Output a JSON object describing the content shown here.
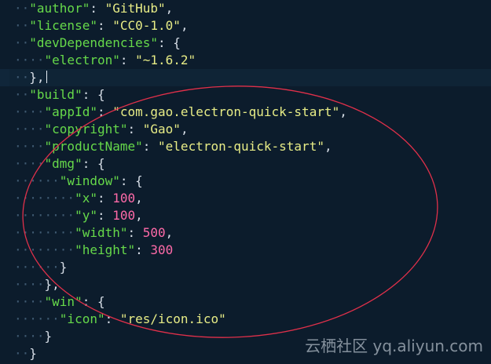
{
  "editor": {
    "lines": [
      {
        "indent": 1,
        "tokens": [
          {
            "t": "k",
            "v": "\"author\""
          },
          {
            "t": "p",
            "v": ": "
          },
          {
            "t": "s",
            "v": "\"GitHub\""
          },
          {
            "t": "p",
            "v": ","
          }
        ]
      },
      {
        "indent": 1,
        "tokens": [
          {
            "t": "k",
            "v": "\"license\""
          },
          {
            "t": "p",
            "v": ": "
          },
          {
            "t": "s",
            "v": "\"CC0-1.0\""
          },
          {
            "t": "p",
            "v": ","
          }
        ]
      },
      {
        "indent": 1,
        "tokens": [
          {
            "t": "k",
            "v": "\"devDependencies\""
          },
          {
            "t": "p",
            "v": ": {"
          }
        ]
      },
      {
        "indent": 2,
        "tokens": [
          {
            "t": "k",
            "v": "\"electron\""
          },
          {
            "t": "p",
            "v": ": "
          },
          {
            "t": "s",
            "v": "\"~1.6.2\""
          }
        ]
      },
      {
        "indent": 1,
        "active": true,
        "cursor": true,
        "tokens": [
          {
            "t": "p",
            "v": "},"
          }
        ]
      },
      {
        "indent": 1,
        "tokens": [
          {
            "t": "k",
            "v": "\"build\""
          },
          {
            "t": "p",
            "v": ": {"
          }
        ]
      },
      {
        "indent": 2,
        "tokens": [
          {
            "t": "k",
            "v": "\"appId\""
          },
          {
            "t": "p",
            "v": ": "
          },
          {
            "t": "s",
            "v": "\"com.gao.electron-quick-start\""
          },
          {
            "t": "p",
            "v": ","
          }
        ]
      },
      {
        "indent": 2,
        "tokens": [
          {
            "t": "k",
            "v": "\"copyright\""
          },
          {
            "t": "p",
            "v": ": "
          },
          {
            "t": "s",
            "v": "\"Gao\""
          },
          {
            "t": "p",
            "v": ","
          }
        ]
      },
      {
        "indent": 2,
        "tokens": [
          {
            "t": "k",
            "v": "\"productName\""
          },
          {
            "t": "p",
            "v": ": "
          },
          {
            "t": "s",
            "v": "\"electron-quick-start\""
          },
          {
            "t": "p",
            "v": ","
          }
        ]
      },
      {
        "indent": 2,
        "tokens": [
          {
            "t": "k",
            "v": "\"dmg\""
          },
          {
            "t": "p",
            "v": ": {"
          }
        ]
      },
      {
        "indent": 3,
        "tokens": [
          {
            "t": "k",
            "v": "\"window\""
          },
          {
            "t": "p",
            "v": ": {"
          }
        ]
      },
      {
        "indent": 4,
        "tokens": [
          {
            "t": "k",
            "v": "\"x\""
          },
          {
            "t": "p",
            "v": ": "
          },
          {
            "t": "n",
            "v": "100"
          },
          {
            "t": "p",
            "v": ","
          }
        ]
      },
      {
        "indent": 4,
        "tokens": [
          {
            "t": "k",
            "v": "\"y\""
          },
          {
            "t": "p",
            "v": ": "
          },
          {
            "t": "n",
            "v": "100"
          },
          {
            "t": "p",
            "v": ","
          }
        ]
      },
      {
        "indent": 4,
        "tokens": [
          {
            "t": "k",
            "v": "\"width\""
          },
          {
            "t": "p",
            "v": ": "
          },
          {
            "t": "n",
            "v": "500"
          },
          {
            "t": "p",
            "v": ","
          }
        ]
      },
      {
        "indent": 4,
        "tokens": [
          {
            "t": "k",
            "v": "\"height\""
          },
          {
            "t": "p",
            "v": ": "
          },
          {
            "t": "n",
            "v": "300"
          }
        ]
      },
      {
        "indent": 3,
        "tokens": [
          {
            "t": "p",
            "v": "}"
          }
        ]
      },
      {
        "indent": 2,
        "tokens": [
          {
            "t": "p",
            "v": "},"
          }
        ]
      },
      {
        "indent": 2,
        "tokens": [
          {
            "t": "k",
            "v": "\"win\""
          },
          {
            "t": "p",
            "v": ": {"
          }
        ]
      },
      {
        "indent": 3,
        "tokens": [
          {
            "t": "k",
            "v": "\"icon\""
          },
          {
            "t": "p",
            "v": ": "
          },
          {
            "t": "s",
            "v": "\"res/icon.ico\""
          }
        ]
      },
      {
        "indent": 2,
        "tokens": [
          {
            "t": "p",
            "v": "}"
          }
        ]
      },
      {
        "indent": 1,
        "tokens": [
          {
            "t": "p",
            "v": "}"
          }
        ]
      }
    ]
  },
  "watermark": {
    "text": "云栖社区 yq.aliyun.com"
  },
  "colors": {
    "background": "#0c1c2c",
    "key": "#66d94a",
    "string": "#e7ec86",
    "number": "#ff6aa8",
    "punctuation": "#d6dde6",
    "indent_guide": "#3f5a72",
    "annotation": "#e0304a"
  }
}
